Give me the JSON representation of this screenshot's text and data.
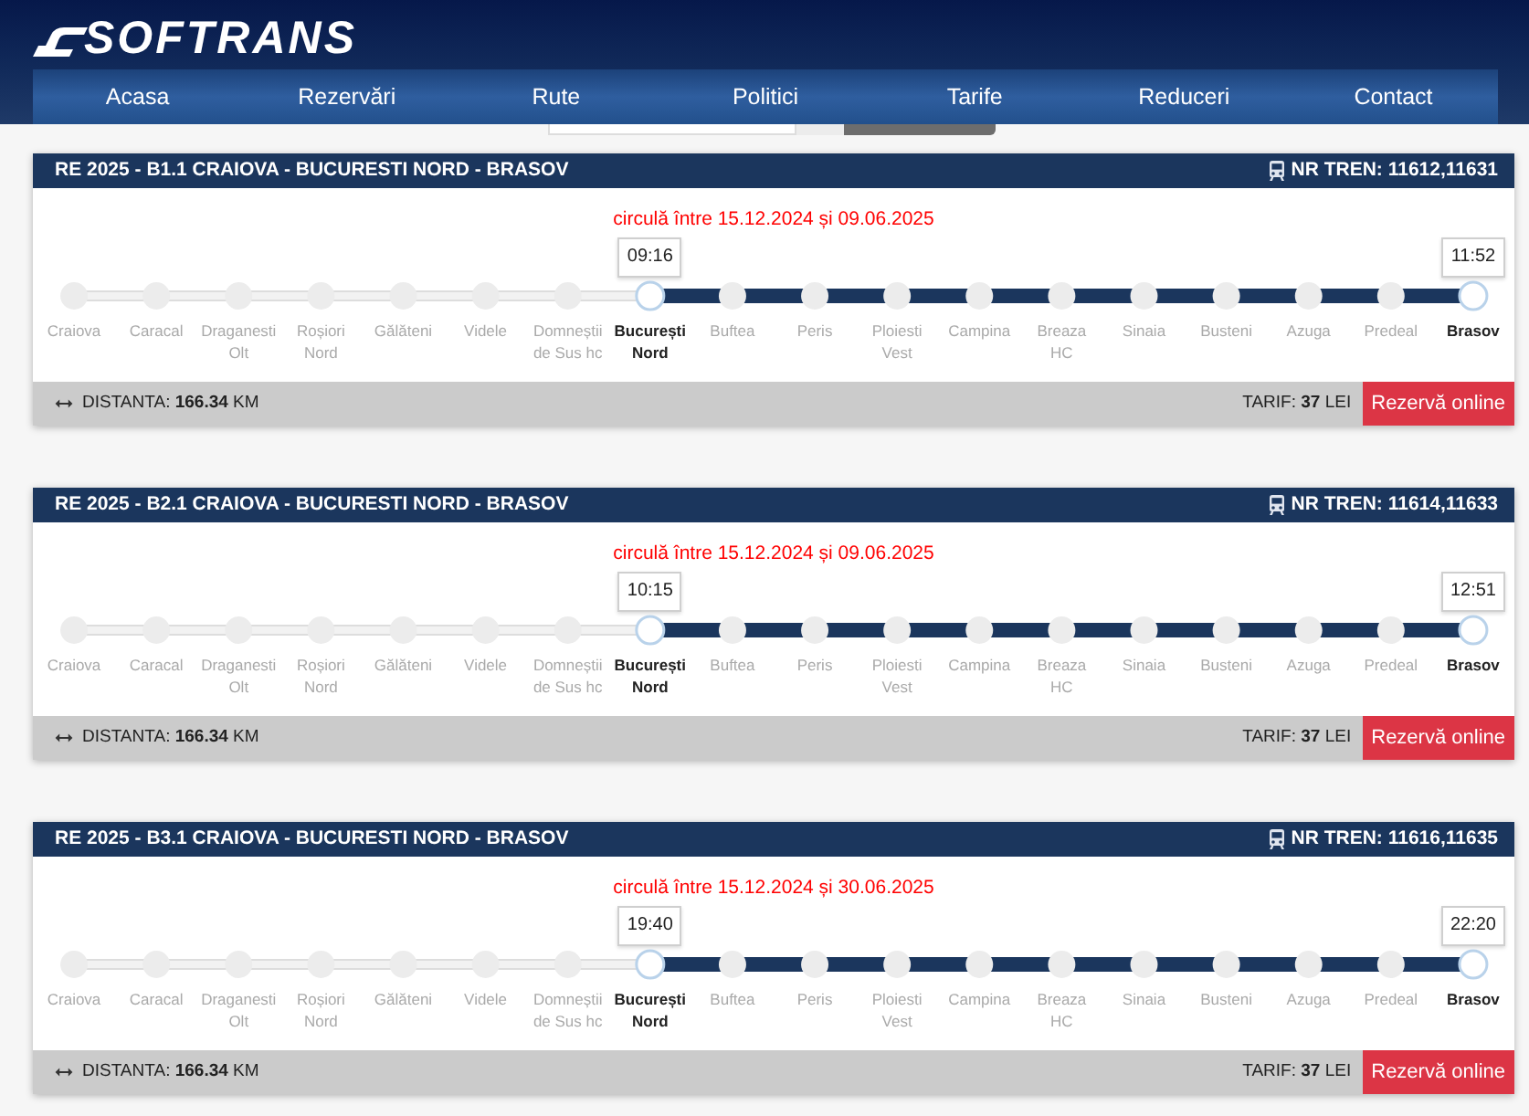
{
  "header": {
    "logo": "SOFTRANS",
    "nav": [
      {
        "label": "Acasa"
      },
      {
        "label": "Rezervări"
      },
      {
        "label": "Rute"
      },
      {
        "label": "Politici"
      },
      {
        "label": "Tarife"
      },
      {
        "label": "Reduceri"
      },
      {
        "label": "Contact"
      }
    ]
  },
  "routes": [
    {
      "title": "RE 2025 - B1.1 CRAIOVA - BUCURESTI NORD - BRASOV",
      "train_numbers": "NR TREN: 11612,11631",
      "validity": "circulă între 15.12.2024 și 09.06.2025",
      "stations": [
        {
          "name": "Craiova",
          "kind": "off_route"
        },
        {
          "name": "Caracal",
          "kind": "off_route"
        },
        {
          "name": "Draganesti\nOlt",
          "kind": "off_route"
        },
        {
          "name": "Roșiori\nNord",
          "kind": "off_route"
        },
        {
          "name": "Gălăteni",
          "kind": "off_route"
        },
        {
          "name": "Videle",
          "kind": "off_route"
        },
        {
          "name": "Domneștii\nde Sus hc",
          "kind": "off_route"
        },
        {
          "name": "București\nNord",
          "kind": "endpoint",
          "time": "09:16"
        },
        {
          "name": "Buftea",
          "kind": "on_route"
        },
        {
          "name": "Peris",
          "kind": "on_route"
        },
        {
          "name": "Ploiesti\nVest",
          "kind": "on_route"
        },
        {
          "name": "Campina",
          "kind": "on_route"
        },
        {
          "name": "Breaza\nHC",
          "kind": "on_route"
        },
        {
          "name": "Sinaia",
          "kind": "on_route"
        },
        {
          "name": "Busteni",
          "kind": "on_route"
        },
        {
          "name": "Azuga",
          "kind": "on_route"
        },
        {
          "name": "Predeal",
          "kind": "on_route"
        },
        {
          "name": "Brasov",
          "kind": "endpoint",
          "time": "11:52"
        }
      ],
      "distance": "DISTANTA: **166.34** KM",
      "fare": "TARIF: **37** LEI",
      "button": "Rezervă online"
    },
    {
      "title": "RE 2025 - B2.1 CRAIOVA - BUCURESTI NORD - BRASOV",
      "train_numbers": "NR TREN: 11614,11633",
      "validity": "circulă între 15.12.2024 și 09.06.2025",
      "stations": [
        {
          "name": "Craiova",
          "kind": "off_route"
        },
        {
          "name": "Caracal",
          "kind": "off_route"
        },
        {
          "name": "Draganesti\nOlt",
          "kind": "off_route"
        },
        {
          "name": "Roșiori\nNord",
          "kind": "off_route"
        },
        {
          "name": "Gălăteni",
          "kind": "off_route"
        },
        {
          "name": "Videle",
          "kind": "off_route"
        },
        {
          "name": "Domneștii\nde Sus hc",
          "kind": "off_route"
        },
        {
          "name": "București\nNord",
          "kind": "endpoint",
          "time": "10:15"
        },
        {
          "name": "Buftea",
          "kind": "on_route"
        },
        {
          "name": "Peris",
          "kind": "on_route"
        },
        {
          "name": "Ploiesti\nVest",
          "kind": "on_route"
        },
        {
          "name": "Campina",
          "kind": "on_route"
        },
        {
          "name": "Breaza\nHC",
          "kind": "on_route"
        },
        {
          "name": "Sinaia",
          "kind": "on_route"
        },
        {
          "name": "Busteni",
          "kind": "on_route"
        },
        {
          "name": "Azuga",
          "kind": "on_route"
        },
        {
          "name": "Predeal",
          "kind": "on_route"
        },
        {
          "name": "Brasov",
          "kind": "endpoint",
          "time": "12:51"
        }
      ],
      "distance": "DISTANTA: **166.34** KM",
      "fare": "TARIF: **37** LEI",
      "button": "Rezervă online"
    },
    {
      "title": "RE 2025 - B3.1 CRAIOVA - BUCURESTI NORD - BRASOV",
      "train_numbers": "NR TREN: 11616,11635",
      "validity": "circulă între 15.12.2024 și 30.06.2025",
      "stations": [
        {
          "name": "Craiova",
          "kind": "off_route"
        },
        {
          "name": "Caracal",
          "kind": "off_route"
        },
        {
          "name": "Draganesti\nOlt",
          "kind": "off_route"
        },
        {
          "name": "Roșiori\nNord",
          "kind": "off_route"
        },
        {
          "name": "Gălăteni",
          "kind": "off_route"
        },
        {
          "name": "Videle",
          "kind": "off_route"
        },
        {
          "name": "Domneștii\nde Sus hc",
          "kind": "off_route"
        },
        {
          "name": "București\nNord",
          "kind": "endpoint",
          "time": "19:40"
        },
        {
          "name": "Buftea",
          "kind": "on_route"
        },
        {
          "name": "Peris",
          "kind": "on_route"
        },
        {
          "name": "Ploiesti\nVest",
          "kind": "on_route"
        },
        {
          "name": "Campina",
          "kind": "on_route"
        },
        {
          "name": "Breaza\nHC",
          "kind": "on_route"
        },
        {
          "name": "Sinaia",
          "kind": "on_route"
        },
        {
          "name": "Busteni",
          "kind": "on_route"
        },
        {
          "name": "Azuga",
          "kind": "on_route"
        },
        {
          "name": "Predeal",
          "kind": "on_route"
        },
        {
          "name": "Brasov",
          "kind": "endpoint",
          "time": "22:20"
        }
      ],
      "distance": "DISTANTA: **166.34** KM",
      "fare": "TARIF: **37** LEI",
      "button": "Rezervă online"
    }
  ]
}
